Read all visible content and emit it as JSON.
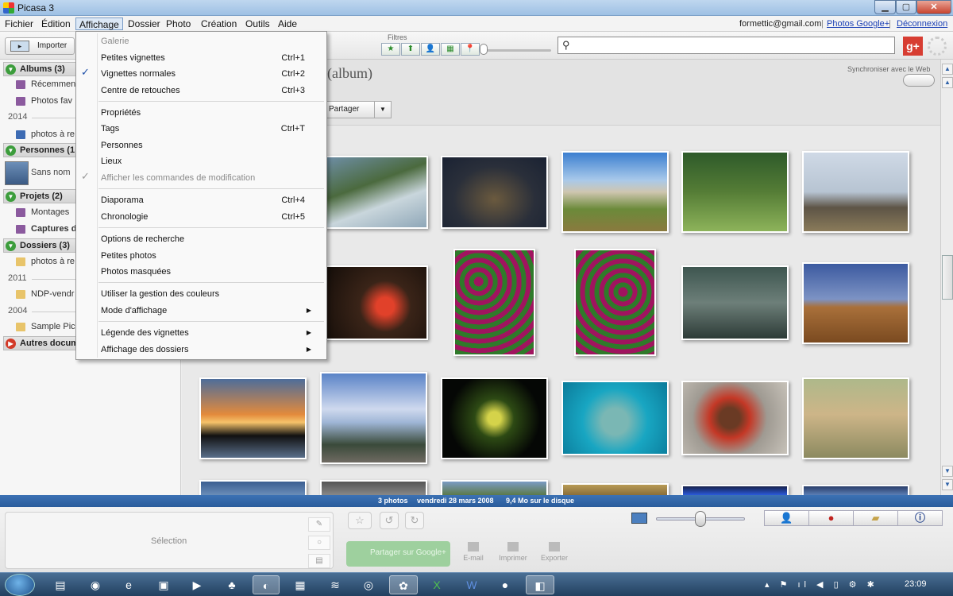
{
  "window": {
    "title": "Picasa 3"
  },
  "menubar": {
    "items": [
      "Fichier",
      "Édition",
      "Affichage",
      "Dossier",
      "Photo",
      "Création",
      "Outils",
      "Aide"
    ],
    "account_email": "formettic@gmail.com",
    "photos_link": "Photos Google+",
    "logout_link": "Déconnexion",
    "separator": "|"
  },
  "toolbar": {
    "import_label": "Importer",
    "filters_label": "Filtres",
    "search_placeholder": ""
  },
  "sidebar": {
    "albums_header": "Albums (3)",
    "album_items": [
      "Récemment",
      "Photos fav"
    ],
    "year_2014": "2014",
    "photos_a_re": "photos à re",
    "persons_header": "Personnes (1",
    "person_unnamed": "Sans nom",
    "projects_header": "Projets (2)",
    "project_items": [
      "Montages",
      "Captures d"
    ],
    "folders_header": "Dossiers (3)",
    "folder_1": "photos à re",
    "year_2011": "2011",
    "folder_2": "NDP-vendr",
    "year_2004": "2004",
    "folder_3": "Sample Pic",
    "other_header": "Autres docum"
  },
  "main": {
    "album_title": "(album)",
    "sync_label": "Synchroniser avec le Web",
    "share_label": "Partager"
  },
  "menu_affichage": {
    "items": [
      {
        "label": "Galerie",
        "shortcut": "",
        "disabled": true
      },
      {
        "label": "Petites vignettes",
        "shortcut": "Ctrl+1"
      },
      {
        "label": "Vignettes normales",
        "shortcut": "Ctrl+2",
        "checked": true
      },
      {
        "label": "Centre de retouches",
        "shortcut": "Ctrl+3"
      },
      {
        "label": "Propriétés",
        "shortcut": ""
      },
      {
        "label": "Tags",
        "shortcut": "Ctrl+T"
      },
      {
        "label": "Personnes",
        "shortcut": ""
      },
      {
        "label": "Lieux",
        "shortcut": ""
      },
      {
        "label": "Afficher les commandes de modification",
        "shortcut": "",
        "disabled": true,
        "checked": true
      },
      {
        "label": "Diaporama",
        "shortcut": "Ctrl+4"
      },
      {
        "label": "Chronologie",
        "shortcut": "Ctrl+5"
      },
      {
        "label": "Options de recherche",
        "shortcut": ""
      },
      {
        "label": "Petites photos",
        "shortcut": ""
      },
      {
        "label": "Photos masquées",
        "shortcut": ""
      },
      {
        "label": "Utiliser la gestion des couleurs",
        "shortcut": ""
      },
      {
        "label": "Mode d'affichage",
        "shortcut": "",
        "submenu": true
      },
      {
        "label": "Légende des vignettes",
        "shortcut": "",
        "submenu": true
      },
      {
        "label": "Affichage des dossiers",
        "shortcut": "",
        "submenu": true
      }
    ]
  },
  "status": {
    "photo_count": "3 photos",
    "date": "vendredi 28 mars 2008",
    "disk": "9,4 Mo sur le disque"
  },
  "tray": {
    "selection_label": "Sélection",
    "share_gplus": "Partager sur Google+",
    "email": "E-mail",
    "print": "Imprimer",
    "export": "Exporter"
  },
  "taskbar": {
    "clock": "23:09"
  },
  "colors": {
    "status_bar": "#2f64a6",
    "gplus": "#d73d32",
    "accent": "#1a3fb5"
  }
}
